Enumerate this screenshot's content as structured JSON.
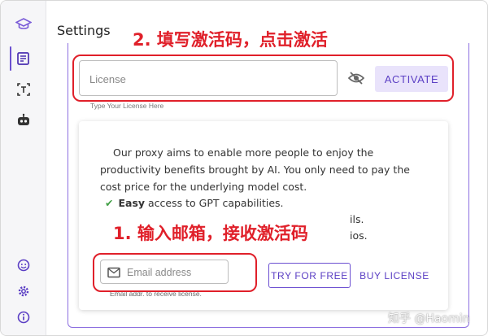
{
  "page": {
    "title": "Settings"
  },
  "sidebar": {
    "top_icons": [
      "graduation-cap-icon",
      "edit-document-icon",
      "text-select-icon",
      "robot-icon"
    ],
    "bottom_icons": [
      "smiley-icon",
      "gear-icon",
      "info-icon"
    ]
  },
  "license": {
    "placeholder": "License",
    "hint": "Type Your License Here",
    "activate_label": "ACTIVATE"
  },
  "card": {
    "description": "Our proxy aims to enable more people to enjoy the productivity benefits brought by AI. You only need to pay the cost price for the underlying model cost.",
    "features": [
      {
        "bold": "Easy",
        "rest": " access to GPT capabilities."
      }
    ],
    "partial_line_1": "ils.",
    "partial_line_2": "ios.",
    "email_placeholder": "Email address",
    "email_hint": "Email addr. to receive license.",
    "try_label": "TRY FOR FREE",
    "buy_label": "BUY LICENSE"
  },
  "annotations": {
    "step2": "2. 填写激活码，点击激活",
    "step1": "1. 输入邮箱，接收激活码"
  },
  "watermark": "知乎 @Haomin",
  "colors": {
    "accent": "#6b4fd1",
    "annotation_red": "#e0202a",
    "check_green": "#43a047"
  }
}
